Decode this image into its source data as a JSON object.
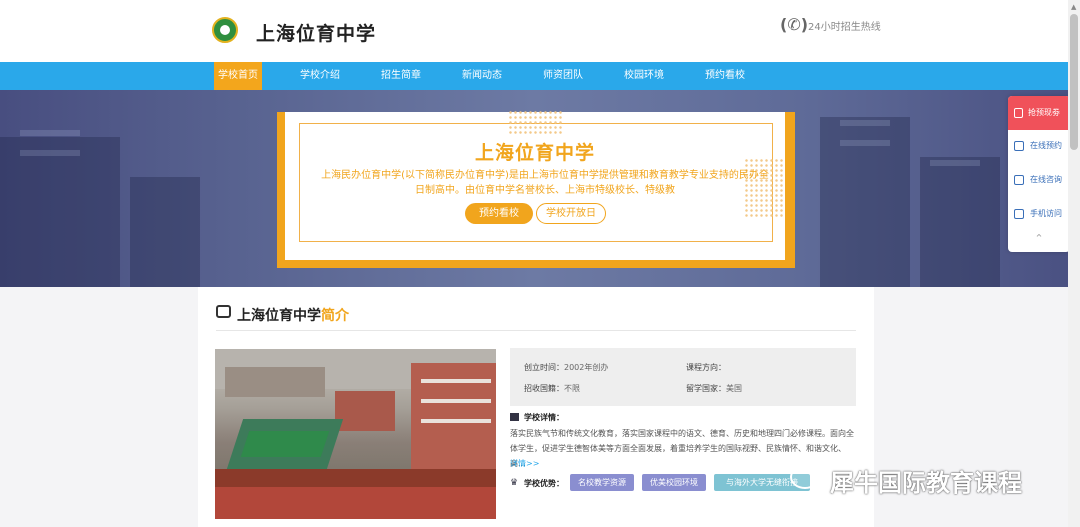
{
  "header": {
    "site_title": "上海位育中学",
    "hotline_label": "24小时招生热线"
  },
  "nav": {
    "items": [
      "学校首页",
      "学校介绍",
      "招生简章",
      "新闻动态",
      "师资团队",
      "校园环境",
      "预约看校"
    ],
    "active_index": 0
  },
  "hero": {
    "title": "上海位育中学",
    "description": "上海民办位育中学(以下简称民办位育中学)是由上海市位育中学提供管理和教育教学专业支持的民办全日制高中。由位育中学名誉校长、上海市特级校长、特级教",
    "btn_visit": "预约看校",
    "btn_open_day": "学校开放日"
  },
  "float_bar": {
    "top": "抢预现劵",
    "items": [
      "在线预约",
      "在线咨询",
      "手机访问"
    ]
  },
  "intro": {
    "title_main": "上海位育中学",
    "title_highlight": "简介",
    "founded_label": "创立时间：",
    "founded_value": "2002年创办",
    "direction_label": "课程方向：",
    "direction_value": "",
    "enroll_label": "招收国籍：",
    "enroll_value": "不限",
    "study_label": "留学国家：",
    "study_value": "美国",
    "detail_title": "学校详情：",
    "detail_text": "落实民族气节和传统文化教育，落实国家课程中的语文、德育、历史和地理四门必修课程。面向全体学生，促进学生德智体美等方面全面发展，着重培养学生的国际视野、民族情怀、和谐文化、高...",
    "more": "详情>>",
    "advantage_title": "学校优势：",
    "tags": [
      "名校教学资源",
      "优美校园环境",
      "与海外大学无缝衔接"
    ]
  },
  "watermark": "犀牛国际教育课程",
  "colors": {
    "nav_blue": "#2aa8ea",
    "accent_orange": "#f1a51d",
    "float_red": "#f0515a",
    "tag_purple": "#8a8ed0",
    "tag_teal": "#7ec3d3"
  }
}
